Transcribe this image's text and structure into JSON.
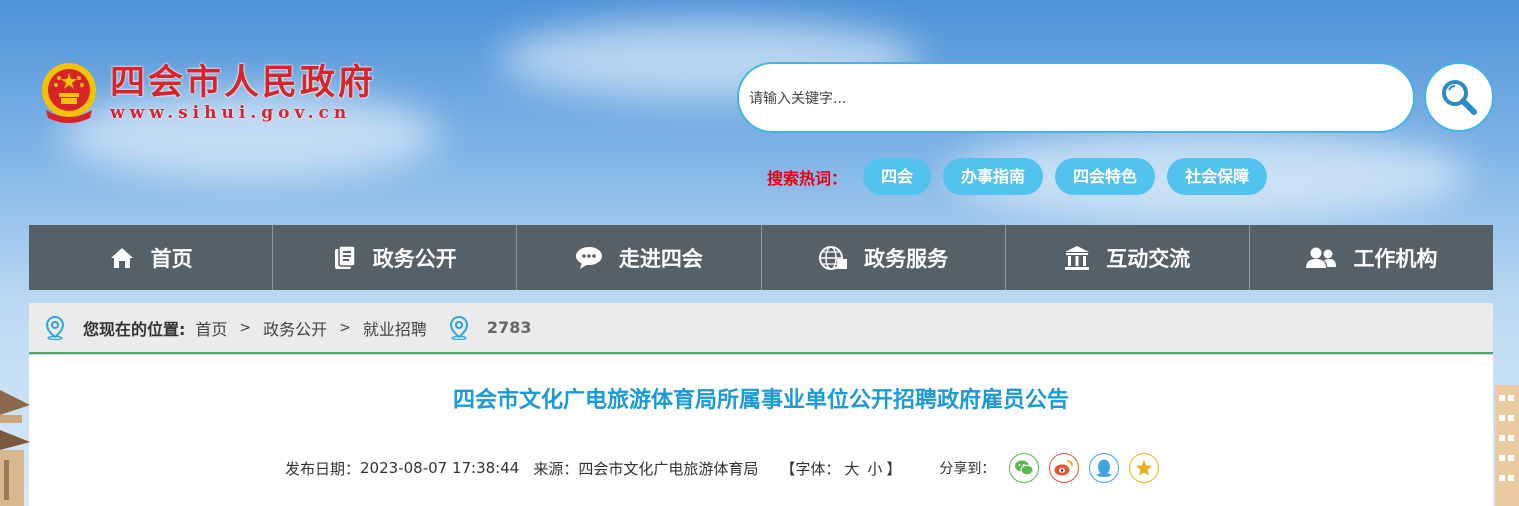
{
  "site": {
    "title": "四会市人民政府",
    "url": "www.sihui.gov.cn"
  },
  "search": {
    "placeholder": "请输入关键字...",
    "hot_label": "搜索热词：",
    "hot_tags": [
      "四会",
      "办事指南",
      "四会特色",
      "社会保障"
    ]
  },
  "nav": {
    "items": [
      {
        "label": "首页",
        "icon": "home-icon"
      },
      {
        "label": "政务公开",
        "icon": "document-icon"
      },
      {
        "label": "走进四会",
        "icon": "chat-bubble-icon"
      },
      {
        "label": "政务服务",
        "icon": "globe-icon"
      },
      {
        "label": "互动交流",
        "icon": "building-icon"
      },
      {
        "label": "工作机构",
        "icon": "users-icon"
      }
    ]
  },
  "breadcrumb": {
    "label": "您现在的位置:",
    "items": [
      "首页",
      "政务公开",
      "就业招聘"
    ],
    "separator": ">",
    "count": "2783"
  },
  "article": {
    "title": "四会市文化广电旅游体育局所属事业单位公开招聘政府雇员公告",
    "date_label": "发布日期：",
    "date": "2023-08-07 17:38:44",
    "source_label": "来源：",
    "source": "四会市文化广电旅游体育局",
    "font_label": "【字体：",
    "font_large": "大",
    "font_small": "小",
    "font_close": "】",
    "share_label": "分享到："
  },
  "colors": {
    "accent": "#42b4e6",
    "hot_tag": "#52c2ef",
    "nav_bg": "#566068",
    "title": "#1a9ad9",
    "brand_red": "#d8232a"
  }
}
